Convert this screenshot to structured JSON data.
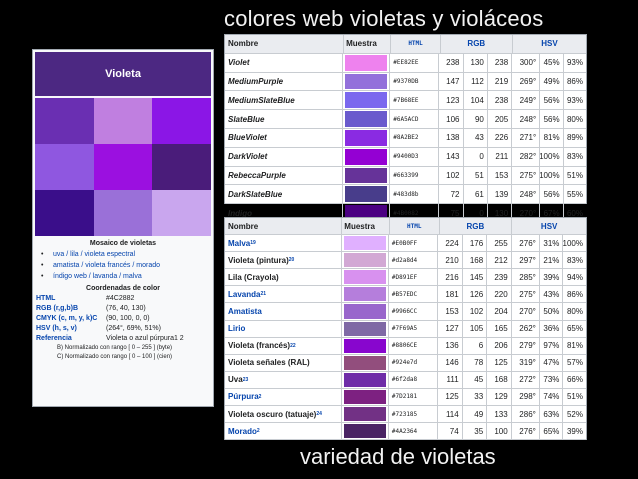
{
  "slide": {
    "title": "colores web violetas y violáceos",
    "caption": "variedad de violetas"
  },
  "infobox": {
    "header": "Violeta",
    "header_color": "#4c2882",
    "swatches": [
      "#6a2fb2",
      "#c07fe0",
      "#8b16e6",
      "#8f57e0",
      "#9b10e0",
      "#4a1c7a",
      "#3a0e8a",
      "#9a70d8",
      "#c9a6ee"
    ],
    "mosaic_caption": "Mosaico de violetas",
    "mosaic_items": [
      "uva / lila / violeta espectral",
      "amatista / violeta francés / morado",
      "índigo web / lavanda / malva"
    ],
    "coord_title": "Coordenadas de color",
    "rows": [
      {
        "k": "HTML",
        "v": "#4C2882"
      },
      {
        "k": "RGB (r,g,b)B",
        "v": "(76, 40, 130)"
      },
      {
        "k": "CMYK (c, m, y, k)C",
        "v": "(90, 100, 0, 0)"
      },
      {
        "k": "HSV (h, s, v)",
        "v": "(264°, 69%, 51%)"
      },
      {
        "k": "Referencia",
        "v": "Violeta o azul púrpura1 2"
      }
    ],
    "footnotes": [
      "B) Normalizado con rango [ 0 – 255 ] (byte)",
      "C) Normalizado con rango [ 0 – 100 ] (cien)"
    ]
  },
  "table1": {
    "headers": {
      "name": "Nombre",
      "sample": "Muestra",
      "html": "HTML",
      "rgb": "RGB",
      "hsv": "HSV"
    },
    "rows": [
      {
        "name": "Violet",
        "color": "#ee82ee",
        "html": "#EE82EE",
        "r": "238",
        "g": "130",
        "b": "238",
        "h": "300°",
        "s": "45%",
        "v": "93%"
      },
      {
        "name": "MediumPurple",
        "color": "#9370db",
        "html": "#9370DB",
        "r": "147",
        "g": "112",
        "b": "219",
        "h": "269°",
        "s": "49%",
        "v": "86%"
      },
      {
        "name": "MediumSlateBlue",
        "color": "#7b68ee",
        "html": "#7B68EE",
        "r": "123",
        "g": "104",
        "b": "238",
        "h": "249°",
        "s": "56%",
        "v": "93%"
      },
      {
        "name": "SlateBlue",
        "color": "#6a5acd",
        "html": "#6A5ACD",
        "r": "106",
        "g": "90",
        "b": "205",
        "h": "248°",
        "s": "56%",
        "v": "80%"
      },
      {
        "name": "BlueViolet",
        "color": "#8a2be2",
        "html": "#8A2BE2",
        "r": "138",
        "g": "43",
        "b": "226",
        "h": "271°",
        "s": "81%",
        "v": "89%"
      },
      {
        "name": "DarkViolet",
        "color": "#9400d3",
        "html": "#9400D3",
        "r": "143",
        "g": "0",
        "b": "211",
        "h": "282°",
        "s": "100%",
        "v": "83%"
      },
      {
        "name": "RebeccaPurple",
        "color": "#663399",
        "html": "#663399",
        "r": "102",
        "g": "51",
        "b": "153",
        "h": "275°",
        "s": "100%",
        "v": "51%"
      },
      {
        "name": "DarkSlateBlue",
        "color": "#483d8b",
        "html": "#483d8b",
        "r": "72",
        "g": "61",
        "b": "139",
        "h": "248°",
        "s": "56%",
        "v": "55%"
      },
      {
        "name": "Indigo",
        "color": "#4b0082",
        "html": "#4B0082",
        "r": "75",
        "g": "0",
        "b": "130",
        "h": "270°",
        "s": "67%",
        "v": "60%"
      }
    ]
  },
  "table2": {
    "headers": {
      "name": "Nombre",
      "sample": "Muestra",
      "html": "HTML",
      "rgb": "RGB",
      "hsv": "HSV"
    },
    "rows": [
      {
        "name": "Malva",
        "sup": "19",
        "link": true,
        "color": "#e0b0ff",
        "html": "#E0B0FF",
        "r": "224",
        "g": "176",
        "b": "255",
        "h": "276°",
        "s": "31%",
        "v": "100%"
      },
      {
        "name": "Violeta (pintura)",
        "sup": "20",
        "link": false,
        "color": "#d2a8d4",
        "html": "#d2a8d4",
        "r": "210",
        "g": "168",
        "b": "212",
        "h": "297°",
        "s": "21%",
        "v": "83%"
      },
      {
        "name": "Lila (Crayola)",
        "sup": "",
        "link": false,
        "color": "#d891ef",
        "html": "#D891EF",
        "r": "216",
        "g": "145",
        "b": "239",
        "h": "285°",
        "s": "39%",
        "v": "94%"
      },
      {
        "name": "Lavanda",
        "sup": "21",
        "link": true,
        "color": "#b57edc",
        "html": "#B57EDC",
        "r": "181",
        "g": "126",
        "b": "220",
        "h": "275°",
        "s": "43%",
        "v": "86%"
      },
      {
        "name": "Amatista",
        "sup": "",
        "link": true,
        "color": "#9966cc",
        "html": "#9966CC",
        "r": "153",
        "g": "102",
        "b": "204",
        "h": "270°",
        "s": "50%",
        "v": "80%"
      },
      {
        "name": "Lirio",
        "sup": "",
        "link": true,
        "color": "#7f69a5",
        "html": "#7F69A5",
        "r": "127",
        "g": "105",
        "b": "165",
        "h": "262°",
        "s": "36%",
        "v": "65%"
      },
      {
        "name": "Violeta (francés)",
        "sup": "22",
        "link": false,
        "color": "#8806ce",
        "html": "#8806CE",
        "r": "136",
        "g": "6",
        "b": "206",
        "h": "279°",
        "s": "97%",
        "v": "81%"
      },
      {
        "name": "Violeta señales (RAL)",
        "sup": "",
        "link": false,
        "color": "#924e7d",
        "html": "#924e7d",
        "r": "146",
        "g": "78",
        "b": "125",
        "h": "319°",
        "s": "47%",
        "v": "57%"
      },
      {
        "name": "Uva",
        "sup": "23",
        "link": false,
        "color": "#6f2da8",
        "html": "#6f2da8",
        "r": "111",
        "g": "45",
        "b": "168",
        "h": "272°",
        "s": "73%",
        "v": "66%"
      },
      {
        "name": "Púrpura",
        "sup": "2",
        "link": true,
        "color": "#7d2181",
        "html": "#7D2181",
        "r": "125",
        "g": "33",
        "b": "129",
        "h": "298°",
        "s": "74%",
        "v": "51%"
      },
      {
        "name": "Violeta oscuro (tatuaje)",
        "sup": "24",
        "link": false,
        "color": "#723185",
        "html": "#723185",
        "r": "114",
        "g": "49",
        "b": "133",
        "h": "286°",
        "s": "63%",
        "v": "52%"
      },
      {
        "name": "Morado",
        "sup": "2",
        "link": true,
        "color": "#4a2364",
        "html": "#4A2364",
        "r": "74",
        "g": "35",
        "b": "100",
        "h": "276°",
        "s": "65%",
        "v": "39%"
      }
    ]
  }
}
